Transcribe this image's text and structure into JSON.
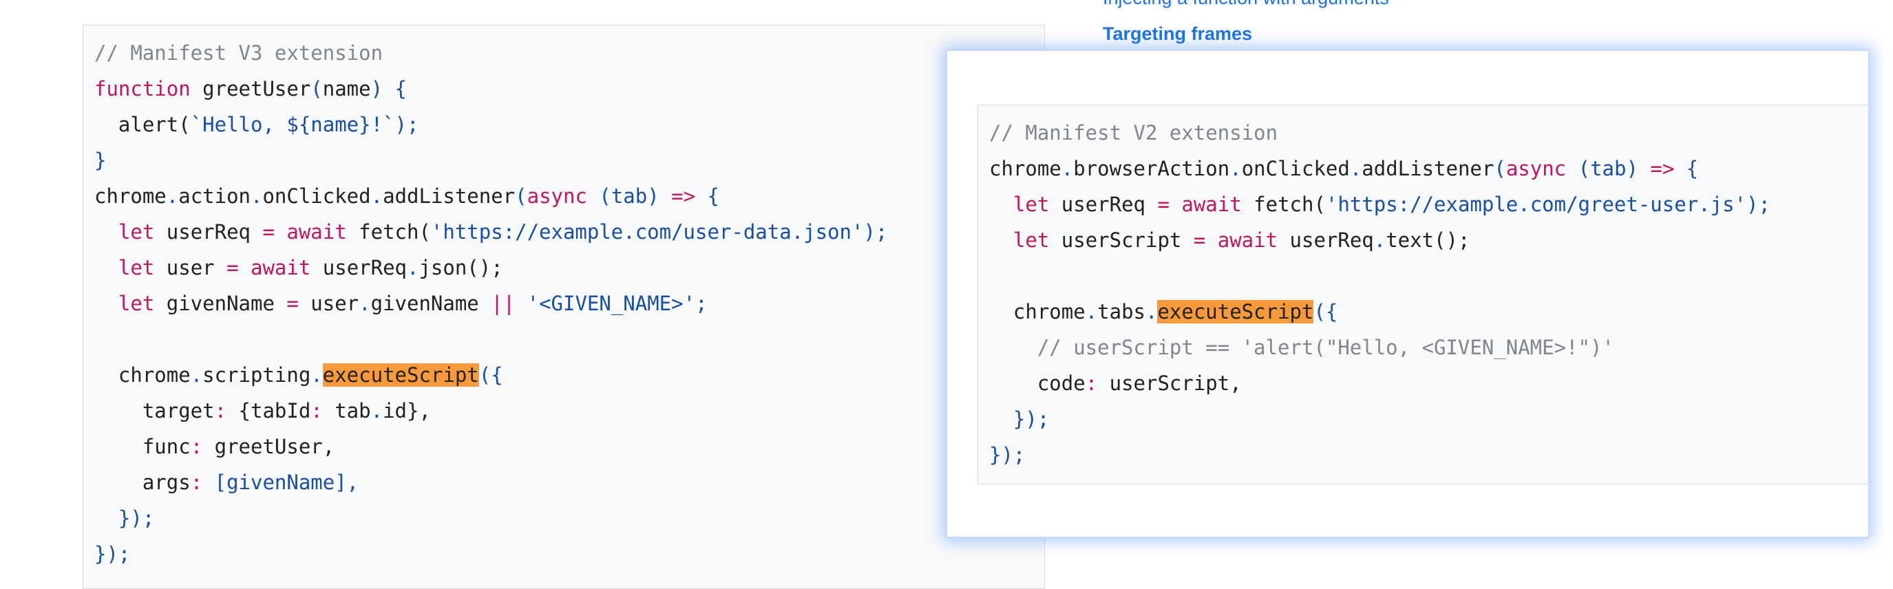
{
  "toc": {
    "partial_item": "Injecting a function with arguments",
    "link": "Targeting frames"
  },
  "code_v3": {
    "comment": "// Manifest V3 extension",
    "kw_function": "function",
    "fn_decl": " greetUser",
    "param_open": "(",
    "param_name": "name",
    "param_close": ") {",
    "alert_call": "  alert(",
    "template_str": "`Hello, ${name}!`",
    "alert_close": ");",
    "brace_close": "}",
    "chrome_id": "chrome",
    "dot1": ".",
    "action_id": "action",
    "dot2": ".",
    "onclicked_id": "onClicked",
    "dot3": ".",
    "addlistener_id": "addListener",
    "paren_open": "(",
    "kw_async": "async",
    "tab_param": " (tab) ",
    "arrow": "=>",
    "brace_open": " {",
    "let1_indent": "  ",
    "let1_kw": "let",
    "let1_var": " userReq ",
    "let1_eq": "=",
    "let1_await": " await",
    "let1_fetch": " fetch(",
    "let1_url": "'https://example.com/user-data.json'",
    "let1_end": ");",
    "let2_indent": "  ",
    "let2_kw": "let",
    "let2_var": " user ",
    "let2_eq": "=",
    "let2_await": " await",
    "let2_call": " userReq",
    "let2_dot": ".",
    "let2_json": "json();",
    "let3_indent": "  ",
    "let3_kw": "let",
    "let3_var": " givenName ",
    "let3_eq": "=",
    "let3_user": " user",
    "let3_dot": ".",
    "let3_prop": "givenName ",
    "let3_or": "||",
    "let3_str": " '<GIVEN_NAME>'",
    "let3_end": ";",
    "exec_prefix": "  chrome",
    "exec_dot1": ".",
    "exec_scripting": "scripting",
    "exec_dot2": ".",
    "exec_fn": "executeScript",
    "exec_open": "({",
    "target_key": "    target",
    "target_colon": ":",
    "target_val": " {tabId",
    "target_colon2": ":",
    "target_tab": " tab",
    "target_dot": ".",
    "target_id": "id},",
    "func_key": "    func",
    "func_colon": ":",
    "func_val": " greetUser,",
    "args_key": "    args",
    "args_colon": ":",
    "args_val": " [givenName],",
    "exec_close": "  });",
    "listener_close": "});"
  },
  "code_v2": {
    "comment": "// Manifest V2 extension",
    "chrome_id": "chrome",
    "dot1": ".",
    "browseraction_id": "browserAction",
    "dot2": ".",
    "onclicked_id": "onClicked",
    "dot3": ".",
    "addlistener_id": "addListener",
    "paren_open": "(",
    "kw_async": "async",
    "tab_param": " (tab) ",
    "arrow": "=>",
    "brace_open": " {",
    "let1_indent": "  ",
    "let1_kw": "let",
    "let1_var": " userReq ",
    "let1_eq": "=",
    "let1_await": " await",
    "let1_fetch": " fetch(",
    "let1_url": "'https://example.com/greet-user.js'",
    "let1_end": ");",
    "let2_indent": "  ",
    "let2_kw": "let",
    "let2_var": " userScript ",
    "let2_eq": "=",
    "let2_await": " await",
    "let2_call": " userReq",
    "let2_dot": ".",
    "let2_text": "text();",
    "exec_prefix": "  chrome",
    "exec_dot1": ".",
    "exec_tabs": "tabs",
    "exec_dot2": ".",
    "exec_fn": "executeScript",
    "exec_open": "({",
    "inner_comment": "    // userScript == 'alert(\"Hello, <GIVEN_NAME>!\")'",
    "code_key": "    code",
    "code_colon": ":",
    "code_val": " userScript,",
    "exec_close": "  });",
    "listener_close": "});"
  },
  "colors": {
    "comment": "#80868b",
    "keyword": "#c5155f",
    "string": "#174ea6",
    "highlight": "#f89a3a",
    "link": "#1a73e8"
  }
}
